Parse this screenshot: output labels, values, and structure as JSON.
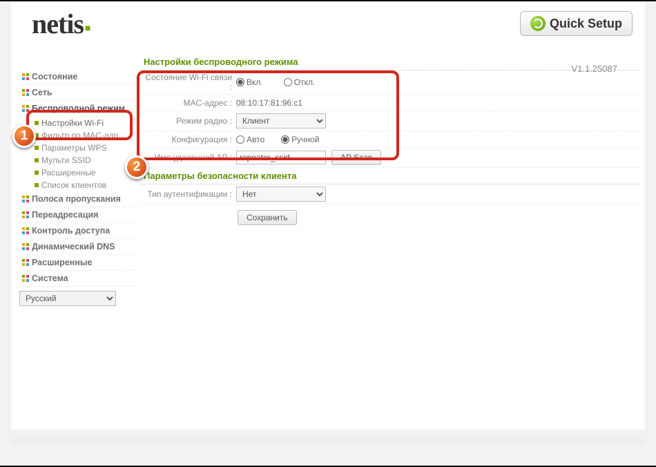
{
  "brand": "netis",
  "quick_setup_label": "Quick Setup",
  "version": "V1.1.25087",
  "sidebar": {
    "items": [
      "Состояние",
      "Сеть",
      "Беспроводной режим",
      "Полоса пропускания",
      "Переадресация",
      "Контроль доступа",
      "Динамический DNS",
      "Расширенные",
      "Система"
    ],
    "wireless_sub": [
      "Настройки Wi-Fi",
      "Фильтр по MAC-адр.",
      "Параметры WPS",
      "Мульти SSID",
      "Расширенные",
      "Список клиентов"
    ],
    "language": "Русский"
  },
  "main": {
    "section1_title": "Настройки беспроводного режима",
    "wifi_state_label": "Состояние Wi-Fi связи :",
    "wifi_state_on": "Вкл.",
    "wifi_state_off": "Откл.",
    "wifi_state_selected": "on",
    "mac_label": "MAC-адрес :",
    "mac_value": "08:10:17:81:96:c1",
    "radio_mode_label": "Режим радио :",
    "radio_mode_value": "Клиент",
    "config_label": "Конфигурация :",
    "config_auto": "Авто",
    "config_manual": "Ручной",
    "config_selected": "manual",
    "remote_ap_label": "Имя удаленной AP :",
    "remote_ap_value": "repeater_ssid",
    "ap_scan": "AP Scan",
    "section2_title": "Параметры безопасности клиента",
    "auth_type_label": "Тип аутентификации :",
    "auth_type_value": "Нет",
    "save": "Сохранить"
  },
  "annotations": {
    "badge1": "1",
    "badge2": "2"
  }
}
